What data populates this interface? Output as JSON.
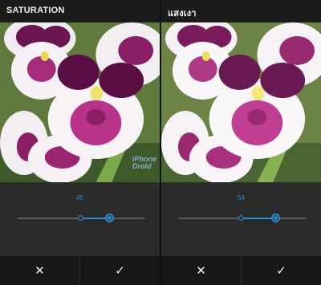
{
  "left_panel": {
    "title": "SATURATION",
    "value": "45",
    "value_fraction": 0.73,
    "cancel_icon": "close-icon",
    "apply_icon": "check-icon"
  },
  "right_panel": {
    "title": "แสงเงา",
    "value": "54",
    "value_fraction": 0.77,
    "cancel_icon": "close-icon",
    "apply_icon": "check-icon"
  },
  "glyphs": {
    "cancel": "✕",
    "apply": "✓"
  },
  "colors": {
    "accent": "#2b8bd1",
    "bar": "#1b1b1b",
    "controls_bg": "#2b2b2b"
  }
}
